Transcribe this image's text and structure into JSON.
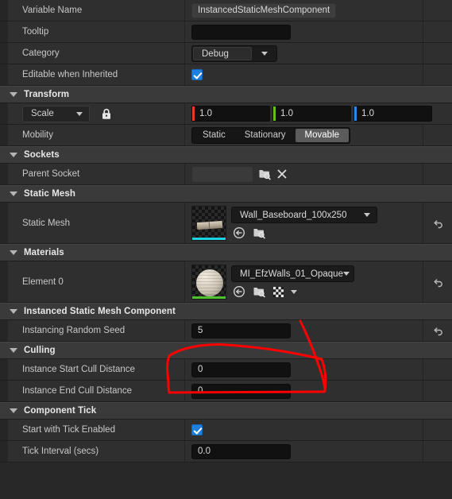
{
  "panel": {
    "app": "unreal-engine-details-panel",
    "accent_red": "#e23a2e",
    "accent_green": "#64c31e",
    "accent_blue": "#2f86f0",
    "checkbox_blue": "#1d7fe0",
    "annotation_color": "#ff0000"
  },
  "rows": {
    "variable_name": {
      "label": "Variable Name",
      "value": "InstancedStaticMeshComponent"
    },
    "tooltip": {
      "label": "Tooltip",
      "value": ""
    },
    "category": {
      "label": "Category",
      "value": "Debug"
    },
    "editable_when_inherited": {
      "label": "Editable when Inherited",
      "checked": true
    }
  },
  "transform": {
    "title": "Transform",
    "scale": {
      "label": "Scale",
      "x": "1.0",
      "y": "1.0",
      "z": "1.0",
      "lock_icon": "lock-closed-icon"
    },
    "mobility": {
      "label": "Mobility",
      "options": [
        "Static",
        "Stationary",
        "Movable"
      ],
      "selected": "Movable"
    }
  },
  "sockets": {
    "title": "Sockets",
    "parent_socket": {
      "label": "Parent Socket",
      "value": ""
    }
  },
  "static_mesh": {
    "title": "Static Mesh",
    "row": {
      "label": "Static Mesh",
      "asset": "Wall_Baseboard_100x250",
      "thumb_bar_color": "#19d4e0"
    }
  },
  "materials": {
    "title": "Materials",
    "row": {
      "label": "Element 0",
      "asset": "MI_EfzWalls_01_Opaque",
      "thumb_bar_color": "#4ec22a"
    }
  },
  "instanced_component": {
    "title": "Instanced Static Mesh Component",
    "random_seed": {
      "label": "Instancing Random Seed",
      "value": "5"
    }
  },
  "culling": {
    "title": "Culling",
    "start_cull": {
      "label": "Instance Start Cull Distance",
      "value": "0"
    },
    "end_cull": {
      "label": "Instance End Cull Distance",
      "value": "0"
    }
  },
  "component_tick": {
    "title": "Component Tick",
    "start_tick": {
      "label": "Start with Tick Enabled",
      "checked": true
    },
    "tick_interval": {
      "label": "Tick Interval (secs)",
      "value": "0.0"
    }
  }
}
